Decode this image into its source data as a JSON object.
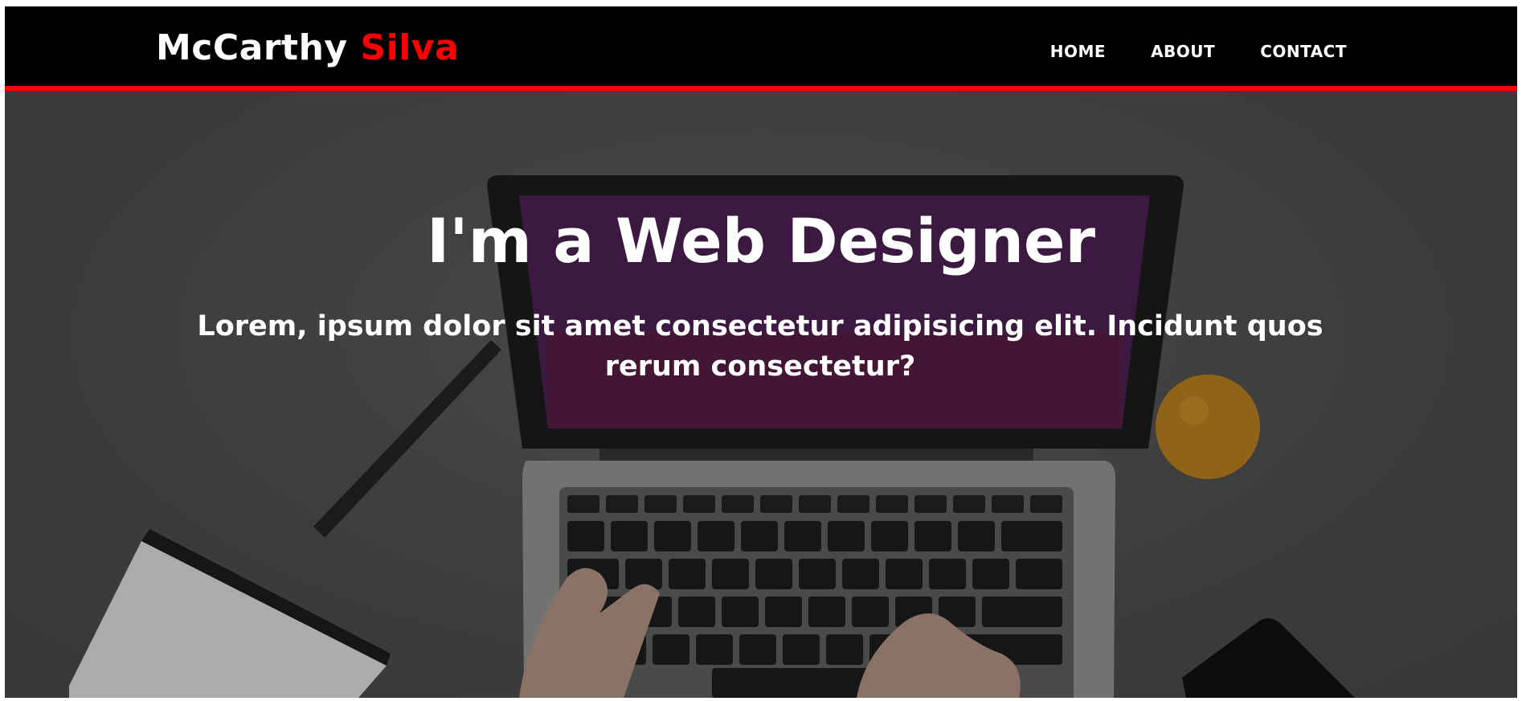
{
  "header": {
    "brand_first": "McCarthy",
    "brand_accent": "Silva",
    "nav": [
      {
        "label": "HOME"
      },
      {
        "label": "ABOUT"
      },
      {
        "label": "CONTACT"
      }
    ]
  },
  "hero": {
    "title": "I'm a Web Designer",
    "subtitle": "Lorem, ipsum dolor sit amet consectetur adipisicing elit. Incidunt quos rerum consectetur?"
  },
  "colors": {
    "accent": "#ff0000",
    "navbar_bg": "#000000",
    "text": "#ffffff"
  }
}
